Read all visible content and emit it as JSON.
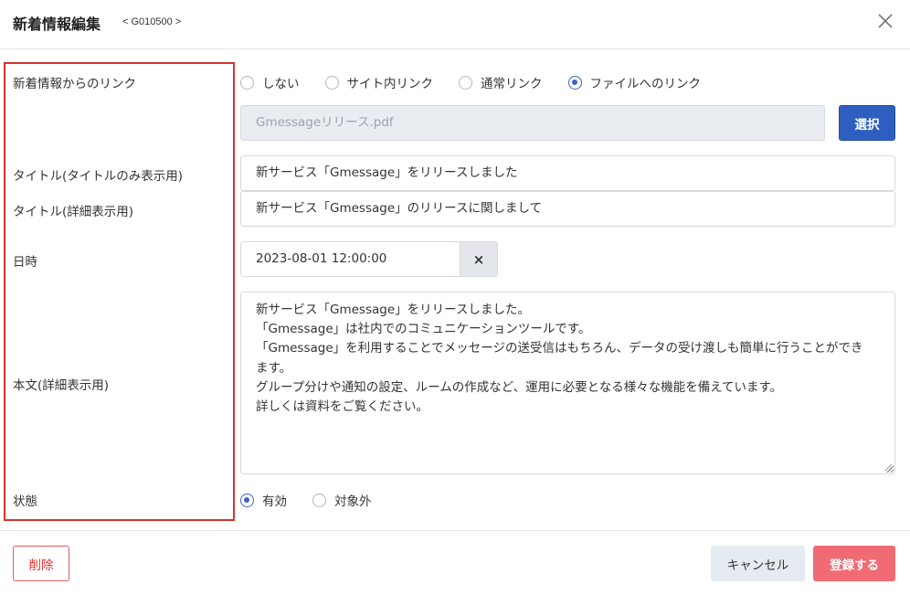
{
  "dialog": {
    "title": "新着情報編集",
    "code": "< G010500 >"
  },
  "form": {
    "link": {
      "label": "新着情報からのリンク",
      "options": [
        "しない",
        "サイト内リンク",
        "通常リンク",
        "ファイルへのリンク"
      ],
      "selected_index": 3
    },
    "file": {
      "value": "Gmessageリリース.pdf",
      "select_label": "選択"
    },
    "title_only": {
      "label": "タイトル(タイトルのみ表示用)",
      "value": "新サービス「Gmessage」をリリースしました"
    },
    "title_detail": {
      "label": "タイトル(詳細表示用)",
      "value": "新サービス「Gmessage」のリリースに関しまして"
    },
    "datetime": {
      "label": "日時",
      "value": "2023-08-01 12:00:00",
      "clear_label": "×"
    },
    "body": {
      "label": "本文(詳細表示用)",
      "lines": [
        "新サービス「Gmessage」をリリースしました。",
        "「Gmessage」は社内でのコミュニケーションツールです。",
        "「Gmessage」を利用することでメッセージの送受信はもちろん、データの受け渡しも簡単に行うことができ",
        "ます。",
        "グループ分けや通知の設定、ルームの作成など、運用に必要となる様々な機能を備えています。",
        "詳しくは資料をご覧ください。"
      ]
    },
    "status": {
      "label": "状態",
      "options": [
        "有効",
        "対象外"
      ],
      "selected_index": 0
    }
  },
  "footer": {
    "delete_label": "削除",
    "cancel_label": "キャンセル",
    "save_label": "登録する"
  },
  "colors": {
    "primary": "#2e5fc0",
    "danger": "#d9322e",
    "save": "#f06b74",
    "radio_on": "#3b63c4"
  }
}
